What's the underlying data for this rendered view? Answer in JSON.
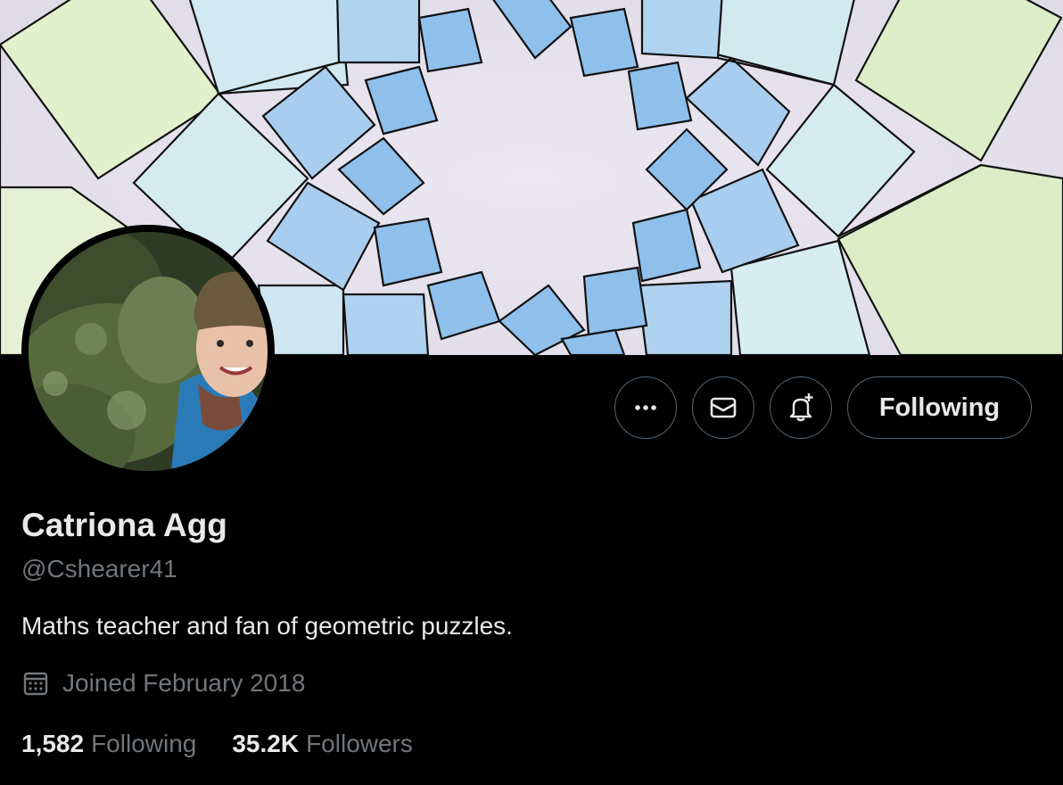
{
  "profile": {
    "name": "Catriona Agg",
    "handle": "@Cshearer41",
    "bio": "Maths teacher and fan of geometric puzzles.",
    "joined": "Joined February 2018",
    "following_count": "1,582",
    "following_label": "Following",
    "followers_count": "35.2K",
    "followers_label": "Followers"
  },
  "actions": {
    "more_icon": "more-icon",
    "message_icon": "mail-icon",
    "notify_icon": "bell-plus-icon",
    "follow_label": "Following"
  },
  "colors": {
    "background": "#000000",
    "primary_text": "#e7e9ea",
    "secondary_text": "#71767b",
    "border": "#536471",
    "banner_paper": "#e8e4ef",
    "square_blue": "#9cc6ec",
    "square_green": "#d8ecc4"
  }
}
